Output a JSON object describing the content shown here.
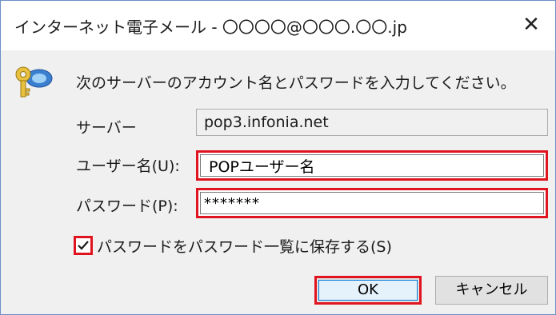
{
  "window": {
    "title": "インターネット電子メール - 〇〇〇〇@〇〇〇.〇〇.jp",
    "close_label": "✕"
  },
  "dialog": {
    "prompt": "次のサーバーのアカウント名とパスワードを入力してください。",
    "icon": "key-icon"
  },
  "form": {
    "server_label": "サーバー",
    "server_value": "pop3.infonia.net",
    "user_label": "ユーザー名(U):",
    "user_value": "POPユーザー名",
    "password_label": "パスワード(P):",
    "password_value": "*******",
    "save_label": "パスワードをパスワード一覧に保存する(S)",
    "save_checked": true
  },
  "buttons": {
    "ok_label": "OK",
    "cancel_label": "キャンセル"
  },
  "colors": {
    "highlight": "#e0141e",
    "dialog_bg": "#f0f0f0"
  }
}
